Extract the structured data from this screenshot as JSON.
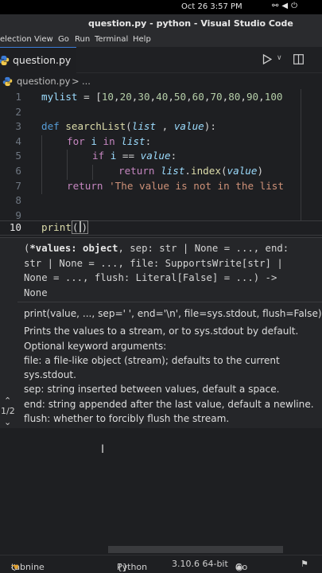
{
  "system": {
    "clock": "Oct 26  3:57 PM"
  },
  "window": {
    "title": "question.py - python - Visual Studio Code"
  },
  "menu": {
    "items": [
      "election",
      "View",
      "Go",
      "Run",
      "Terminal",
      "Help"
    ]
  },
  "tab": {
    "label": "question.py"
  },
  "breadcrumb": {
    "file": "question.py",
    "sep": ">",
    "more": "..."
  },
  "editor": {
    "line_numbers": [
      "1",
      "2",
      "3",
      "4",
      "5",
      "6",
      "7",
      "8",
      "9",
      "10"
    ],
    "l1": {
      "a": "mylist",
      "b": " = [",
      "c": "10",
      "d": ",",
      "e": "20",
      "f": ",",
      "g": "30",
      "h": ",",
      "i": "40",
      "j": ",",
      "k": "50",
      "l": ",",
      "m": "60",
      "n": ",",
      "o": "70",
      "p": ",",
      "q": "80",
      "r": ",",
      "s": "90",
      "t": ",",
      "u": "100"
    },
    "l3": {
      "def": "def",
      "name": " searchList",
      "open": "(",
      "p1": "list",
      "comma": " , ",
      "p2": "value",
      "close": "):"
    },
    "l4": {
      "for": "for",
      "i": " i ",
      "in": "in",
      "list": " list",
      "colon": ":"
    },
    "l5": {
      "if": "if",
      "i": " i ",
      "eq": "== ",
      "value": "value",
      "colon": ":"
    },
    "l6": {
      "return": "return",
      "list": " list",
      "dot": ".",
      "index": "index",
      "open": "(",
      "value": "value",
      "close": ")"
    },
    "l7": {
      "return": "return",
      "str": " 'The value is not in the list"
    },
    "l10": {
      "print": "print",
      "open": "(",
      "close": ")"
    }
  },
  "hover": {
    "signature": [
      "(*values: object, sep: str | None = ..., end:",
      "str | None = ..., file: SupportsWrite[str] |",
      "None = ..., flush: Literal[False] = ...) ->",
      "None"
    ],
    "signature_bold": "*values: object",
    "doc": [
      "print(value, ..., sep=' ', end='\\n', file=sys.stdout, flush=False)",
      "",
      "Prints the values to a stream, or to sys.stdout by default.",
      "Optional keyword arguments:",
      "file: a file-like object (stream); defaults to the current",
      "sys.stdout.",
      "sep: string inserted between values, default a space.",
      "end: string appended after the last value, default a newline.",
      "flush: whether to forcibly flush the stream."
    ],
    "overload": "1/2"
  },
  "status": {
    "tabnine": "tabnine starter",
    "python": "Python",
    "version": "3.10.6 64-bit",
    "golive": "Go Live"
  },
  "colors": {
    "keyword": "#c586c0",
    "string": "#ce9178",
    "number": "#b5cea8",
    "function": "#dcdcaa",
    "variable": "#9cdcfe"
  }
}
